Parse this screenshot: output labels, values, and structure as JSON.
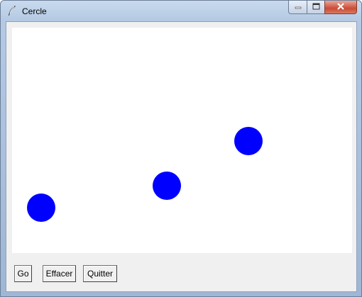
{
  "window": {
    "title": "Cercle",
    "controls": [
      "minimize",
      "maximize",
      "close"
    ]
  },
  "canvas": {
    "background": "#ffffff",
    "circles": [
      {
        "name": "circle-1",
        "color": "#0000ff"
      },
      {
        "name": "circle-2",
        "color": "#0000ff"
      },
      {
        "name": "circle-3",
        "color": "#0000ff"
      }
    ]
  },
  "buttons": {
    "go_label": "Go",
    "clear_label": "Effacer",
    "quit_label": "Quitter"
  },
  "icons": {
    "app": "feather-icon",
    "minimize": "minimize-icon",
    "maximize": "maximize-icon",
    "close": "close-icon"
  }
}
